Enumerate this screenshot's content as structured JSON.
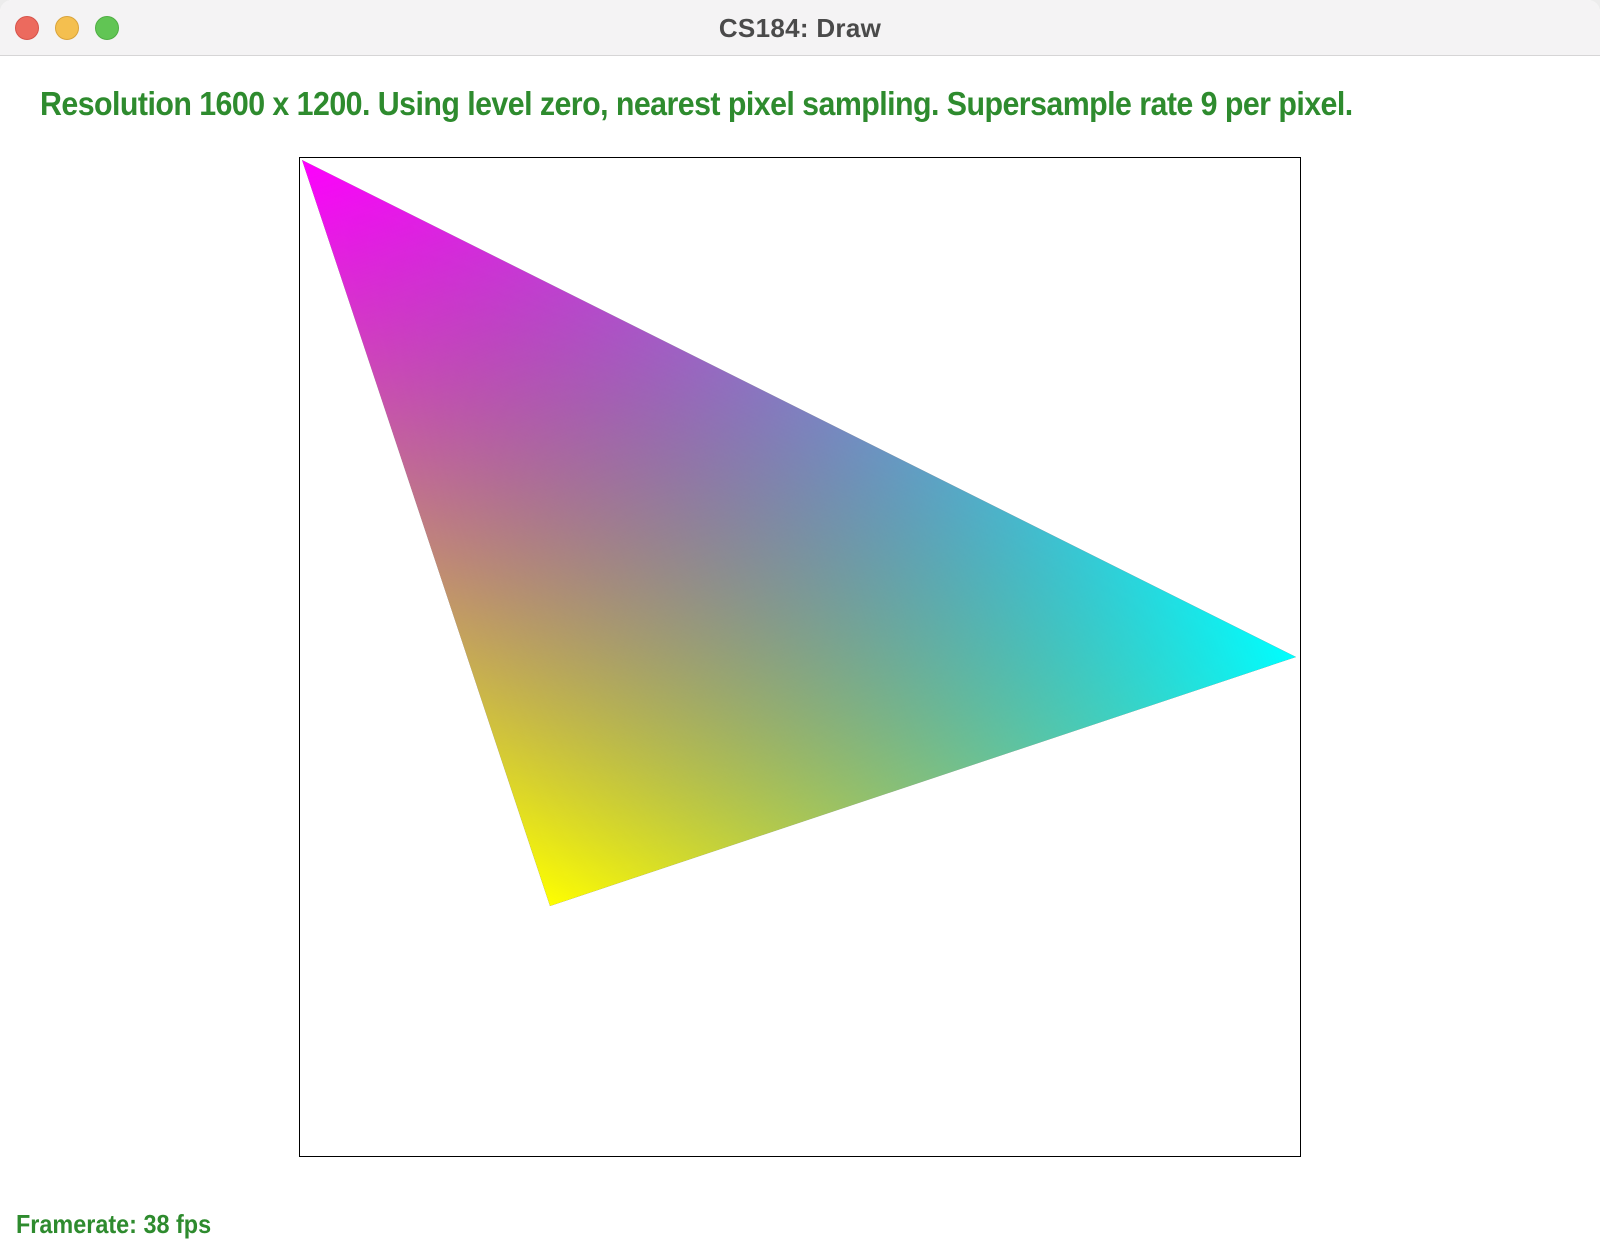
{
  "window": {
    "title": "CS184: Draw"
  },
  "status": {
    "text": "Resolution 1600 x 1200. Using level zero, nearest pixel sampling. Supersample rate 9 per pixel."
  },
  "triangle": {
    "vertex_colors": {
      "top_left": "#ff00ff",
      "right": "#00ffff",
      "bottom": "#ffff00"
    }
  },
  "footer": {
    "framerate_text": "Framerate: 38 fps"
  }
}
